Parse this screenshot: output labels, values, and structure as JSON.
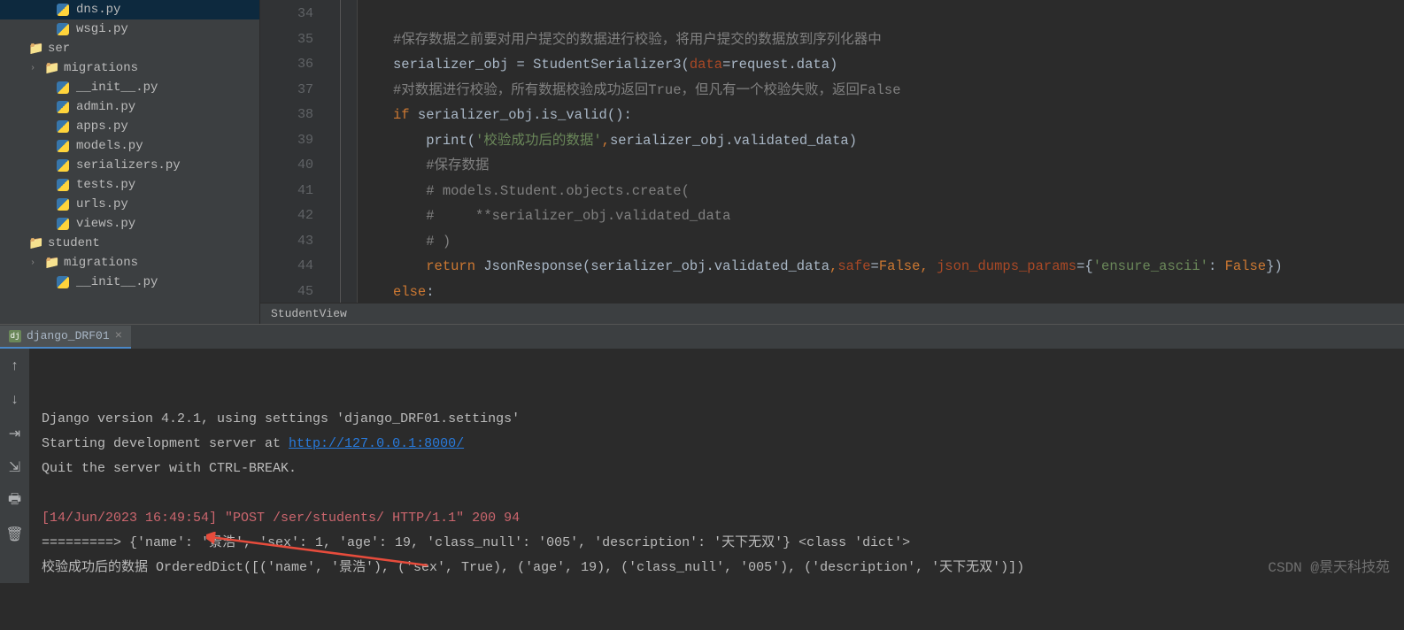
{
  "sidebar": {
    "items": [
      {
        "name": "dns.py",
        "type": "py",
        "indent": 3
      },
      {
        "name": "wsgi.py",
        "type": "py",
        "indent": 3
      },
      {
        "name": "ser",
        "type": "folder",
        "indent": 1
      },
      {
        "name": "migrations",
        "type": "folder",
        "indent": 2,
        "expandable": true
      },
      {
        "name": "__init__.py",
        "type": "py",
        "indent": 3
      },
      {
        "name": "admin.py",
        "type": "py",
        "indent": 3
      },
      {
        "name": "apps.py",
        "type": "py",
        "indent": 3
      },
      {
        "name": "models.py",
        "type": "py",
        "indent": 3
      },
      {
        "name": "serializers.py",
        "type": "py",
        "indent": 3
      },
      {
        "name": "tests.py",
        "type": "py",
        "indent": 3
      },
      {
        "name": "urls.py",
        "type": "py",
        "indent": 3
      },
      {
        "name": "views.py",
        "type": "py",
        "indent": 3
      },
      {
        "name": "student",
        "type": "folder",
        "indent": 1
      },
      {
        "name": "migrations",
        "type": "folder",
        "indent": 2,
        "expandable": true
      },
      {
        "name": "__init__.py",
        "type": "py",
        "indent": 3
      }
    ]
  },
  "editor": {
    "breadcrumb": "StudentView",
    "line_start": 34,
    "lines": [
      {
        "n": 34,
        "html": ""
      },
      {
        "n": 35,
        "html": "<span class='comment'>#保存数据之前要对用户提交的数据进行校验，将用户提交的数据放到序列化器中</span>"
      },
      {
        "n": 36,
        "html": "<span class='ident'>serializer_obj = StudentSerializer3(</span><span class='param'>data</span><span class='ident'>=request.data)</span>"
      },
      {
        "n": 37,
        "html": "<span class='comment'>#对数据进行校验，所有数据校验成功返回True，但凡有一个校验失败，返回False</span>"
      },
      {
        "n": 38,
        "html": "<span class='kw'>if </span><span class='ident'>serializer_obj.is_valid():</span>"
      },
      {
        "n": 39,
        "html": "    <span class='ident'>print(</span><span class='str'>'校验成功后的数据'</span><span class='kw'>,</span><span class='ident'>serializer_obj.validated_data)</span>"
      },
      {
        "n": 40,
        "html": "    <span class='comment'>#保存数据</span>"
      },
      {
        "n": 41,
        "html": "    <span class='comment'># models.Student.objects.create(</span>"
      },
      {
        "n": 42,
        "html": "    <span class='comment'>#     **serializer_obj.validated_data</span>"
      },
      {
        "n": 43,
        "html": "    <span class='comment'># )</span>"
      },
      {
        "n": 44,
        "html": "    <span class='kw'>return </span><span class='ident'>JsonResponse(serializer_obj.validated_data</span><span class='kw'>,</span><span class='param'>safe</span><span class='ident'>=</span><span class='kw'>False, </span><span class='param'>json_dumps_params</span><span class='ident'>={</span><span class='str'>'ensure_ascii'</span><span class='ident'>: </span><span class='kw'>False</span><span class='ident'>})</span>"
      },
      {
        "n": 45,
        "html": "<span class='kw'>else</span><span class='ident'>:</span>"
      }
    ]
  },
  "terminal": {
    "tab_label": "django_DRF01",
    "lines": [
      {
        "text": "Django version 4.2.1, using settings 'django_DRF01.settings'"
      },
      {
        "prefix": "Starting development server at ",
        "link": "http://127.0.0.1:8000/"
      },
      {
        "text": "Quit the server with CTRL-BREAK."
      },
      {
        "text": ""
      },
      {
        "req": "[14/Jun/2023 16:49:54] \"POST /ser/students/ HTTP/1.1\" 200 94"
      },
      {
        "text": "=========> {'name': '景浩', 'sex': 1, 'age': 19, 'class_null': '005', 'description': '天下无双'} <class 'dict'>"
      },
      {
        "text": "校验成功后的数据 OrderedDict([('name', '景浩'), ('sex', True), ('age', 19), ('class_null', '005'), ('description', '天下无双')])"
      }
    ]
  },
  "watermark": "CSDN @景天科技苑"
}
